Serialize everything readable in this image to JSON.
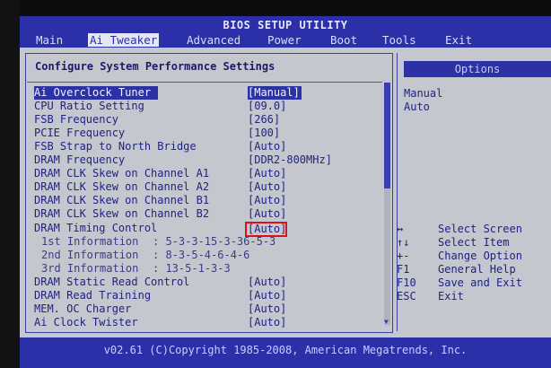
{
  "title": "BIOS SETUP UTILITY",
  "menu": [
    "Main",
    "Ai Tweaker",
    "Advanced",
    "Power",
    "Boot",
    "Tools",
    "Exit"
  ],
  "active_menu": "Ai Tweaker",
  "section_title": "Configure System Performance Settings",
  "options_header": "Options",
  "settings": [
    {
      "label": "Ai Overclock Tuner",
      "value": "[Manual]"
    },
    {
      "label": "CPU Ratio Setting",
      "value": "[09.0]"
    },
    {
      "label": "FSB Frequency",
      "value": "[266]"
    },
    {
      "label": "PCIE Frequency",
      "value": "[100]"
    },
    {
      "label": "FSB Strap to North Bridge",
      "value": "[Auto]"
    },
    {
      "label": "DRAM Frequency",
      "value": "[DDR2-800MHz]"
    },
    {
      "label": "DRAM CLK Skew on Channel A1",
      "value": "[Auto]"
    },
    {
      "label": "DRAM CLK Skew on Channel A2",
      "value": "[Auto]"
    },
    {
      "label": "DRAM CLK Skew on Channel B1",
      "value": "[Auto]"
    },
    {
      "label": "DRAM CLK Skew on Channel B2",
      "value": "[Auto]"
    },
    {
      "label": "DRAM Timing Control",
      "value": "[Auto]"
    }
  ],
  "info_lines": [
    {
      "label": "1st Information",
      "value": ": 5-3-3-15-3-36-5-3"
    },
    {
      "label": "2nd Information",
      "value": ": 8-3-5-4-6-4-6"
    },
    {
      "label": "3rd Information",
      "value": ": 13-5-1-3-3"
    }
  ],
  "settings_bottom": [
    {
      "label": "DRAM Static Read Control",
      "value": "[Auto]"
    },
    {
      "label": "DRAM Read Training",
      "value": "[Auto]"
    },
    {
      "label": "MEM. OC Charger",
      "value": "[Auto]"
    },
    {
      "label": "Ai Clock Twister",
      "value": "[Auto]"
    }
  ],
  "options": [
    "Manual",
    "Auto"
  ],
  "help": [
    {
      "key": "↔",
      "text": "Select Screen"
    },
    {
      "key": "↑↓",
      "text": "Select Item"
    },
    {
      "key": "+-",
      "text": "Change Option"
    },
    {
      "key": "F1",
      "text": "General Help"
    },
    {
      "key": "F10",
      "text": "Save and Exit"
    },
    {
      "key": "ESC",
      "text": "Exit"
    }
  ],
  "footer": "v02.61 (C)Copyright 1985-2008, American Megatrends, Inc.",
  "colors": {
    "bios_blue": "#2b2fa8",
    "panel_gray": "#c5c7cf",
    "highlight_red": "#e01010"
  }
}
